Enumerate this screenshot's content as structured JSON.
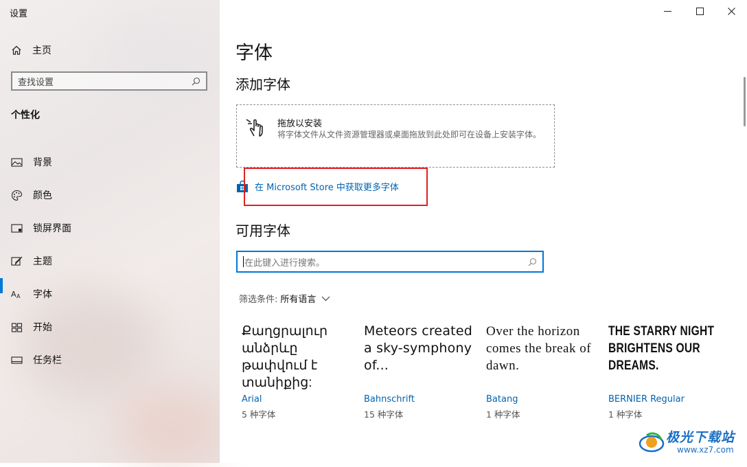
{
  "window": {
    "title": "设置",
    "controls": {
      "minimize_icon": "minimize-icon",
      "maximize_icon": "maximize-icon",
      "close_icon": "close-icon"
    }
  },
  "sidebar": {
    "home": {
      "label": "主页",
      "icon": "home-icon"
    },
    "search": {
      "placeholder": "查找设置",
      "icon": "search-icon"
    },
    "section_title": "个性化",
    "items": [
      {
        "label": "背景",
        "icon": "picture-icon"
      },
      {
        "label": "颜色",
        "icon": "palette-icon"
      },
      {
        "label": "锁屏界面",
        "icon": "lock-screen-icon"
      },
      {
        "label": "主题",
        "icon": "theme-icon"
      },
      {
        "label": "字体",
        "icon": "font-icon",
        "active": true
      },
      {
        "label": "开始",
        "icon": "start-icon"
      },
      {
        "label": "任务栏",
        "icon": "taskbar-icon"
      }
    ]
  },
  "main": {
    "page_title": "字体",
    "add_fonts": {
      "heading": "添加字体",
      "drop_title": "拖放以安装",
      "drop_description": "将字体文件从文件资源管理器或桌面拖放到此处即可在设备上安装字体。",
      "store_link": "在 Microsoft Store 中获取更多字体"
    },
    "available_fonts": {
      "heading": "可用字体",
      "search_placeholder": "在此键入进行搜索。",
      "filter_label": "筛选条件:",
      "filter_value": "所有语言"
    },
    "font_cards": [
      {
        "preview": "Քաղցրալուր անձրևը թափվում է տանիքից:",
        "name": "Arial",
        "count": "5 种字体"
      },
      {
        "preview": "Meteors created a sky-symphony of...",
        "name": "Bahnschrift",
        "count": "15 种字体"
      },
      {
        "preview": "Over the horizon comes the break of dawn.",
        "name": "Batang",
        "count": "1 种字体"
      },
      {
        "preview": "THE STARRY NIGHT BRIGHTENS OUR DREAMS.",
        "name": "BERNIER Regular",
        "count": "1 种字体"
      }
    ]
  },
  "watermark": {
    "brand": "极光下载站",
    "url": "www.xz7.com"
  },
  "colors": {
    "accent": "#0078d7",
    "link": "#0063b1",
    "highlight_box": "#e02020"
  }
}
